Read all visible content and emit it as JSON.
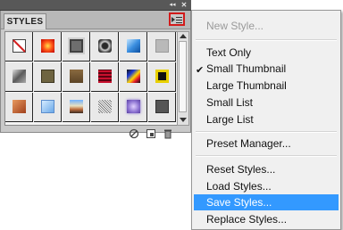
{
  "panel": {
    "tab_label": "STYLES",
    "collapse_glyph": "◂◂",
    "close_glyph": "✕",
    "menu_button_icon": "panel-menu-icon",
    "footer_icons": [
      "clear-style-icon",
      "new-style-icon",
      "delete-icon"
    ]
  },
  "styles_grid": {
    "swatches": [
      "no-style",
      "red-glow",
      "gray-square",
      "chrome-ring",
      "blue-glass",
      "light-gray",
      "brushed-metal",
      "olive-bevel",
      "brown-wood",
      "red-stripes",
      "rainbow-stripe",
      "yellow-frame",
      "burnt-orange",
      "sky-blue",
      "sunset-gradient",
      "starburst",
      "purple-haze",
      "dark-gray"
    ]
  },
  "menu": {
    "new_style": "New Style...",
    "text_only": "Text Only",
    "small_thumbnail": "Small Thumbnail",
    "large_thumbnail": "Large Thumbnail",
    "small_list": "Small List",
    "large_list": "Large List",
    "preset_manager": "Preset Manager...",
    "reset_styles": "Reset Styles...",
    "load_styles": "Load Styles...",
    "save_styles": "Save Styles...",
    "replace_styles": "Replace Styles...",
    "checked_item": "Small Thumbnail",
    "highlighted_item": "Save Styles...",
    "check_glyph": "✔"
  },
  "colors": {
    "highlight": "#3399ff",
    "menu_button_border": "#d21a1a",
    "disabled_text": "#9a9a9a"
  }
}
